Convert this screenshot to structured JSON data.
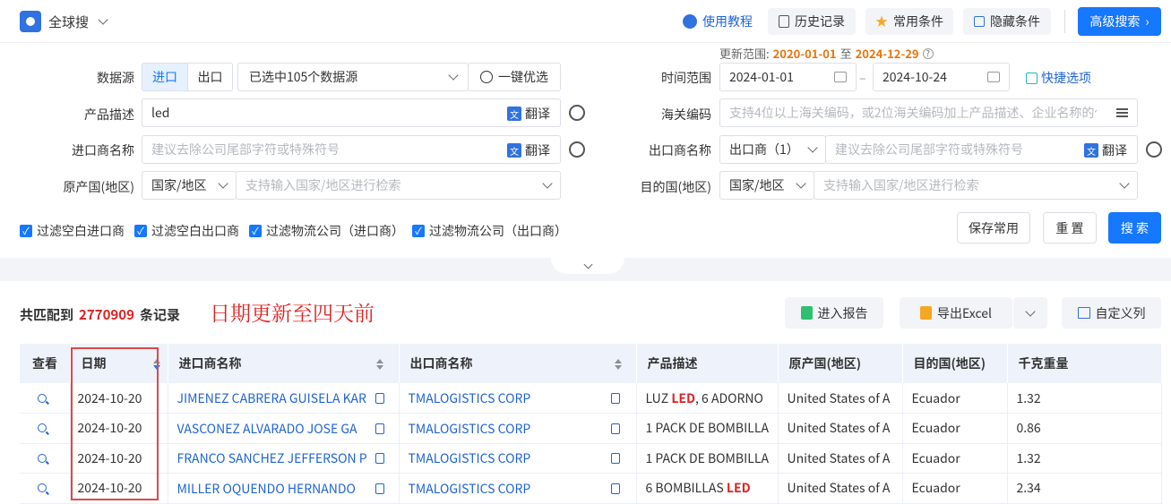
{
  "header": {
    "scope_label": "全球搜",
    "tutorial_label": "使用教程",
    "history_label": "历史记录",
    "favorites_label": "常用条件",
    "hide_label": "隐藏条件",
    "advanced_label": "高级搜索"
  },
  "update_range": {
    "prefix": "更新范围:",
    "start": "2020-01-01",
    "sep": "至",
    "end": "2024-12-29"
  },
  "form": {
    "data_source_label": "数据源",
    "import_label": "进口",
    "export_label": "出口",
    "sources_selected": "已选中105个数据源",
    "one_click_label": "一键优选",
    "time_range_label": "时间范围",
    "date_start": "2024-01-01",
    "date_end": "2024-10-24",
    "quick_options_label": "快捷选项",
    "product_label": "产品描述",
    "product_value": "led",
    "translate_label": "翻译",
    "hs_label": "海关编码",
    "hs_placeholder": "支持4位以上海关编码，或2位海关编码加上产品描述、企业名称的任...",
    "importer_label": "进口商名称",
    "importer_placeholder": "建议去除公司尾部字符或特殊符号",
    "exporter_label": "出口商名称",
    "exporter_select": "出口商（1）",
    "exporter_placeholder": "建议去除公司尾部字符或特殊符号",
    "origin_label": "原产国(地区)",
    "origin_select": "国家/地区",
    "origin_placeholder": "支持输入国家/地区进行检索",
    "dest_label": "目的国(地区)",
    "dest_select": "国家/地区",
    "dest_placeholder": "支持输入国家/地区进行检索",
    "filters": [
      "过滤空白进口商",
      "过滤空白出口商",
      "过滤物流公司（进口商）",
      "过滤物流公司（出口商）"
    ],
    "save_label": "保存常用",
    "reset_label": "重 置",
    "search_label": "搜 索"
  },
  "results": {
    "prefix": "共匹配到",
    "count": "2770909",
    "suffix": "条记录",
    "annotation": "日期更新至四天前",
    "report_label": "进入报告",
    "excel_label": "导出Excel",
    "custom_cols_label": "自定义列"
  },
  "table": {
    "headers": [
      "查看",
      "日期",
      "进口商名称",
      "出口商名称",
      "产品描述",
      "原产国(地区)",
      "目的国(地区)",
      "千克重量"
    ],
    "rows": [
      {
        "date": "2024-10-20",
        "importer": "JIMENEZ CABRERA GUISELA KAR",
        "exporter": "TMALOGISTICS CORP",
        "desc_pre": "LUZ ",
        "desc_hl": "LED",
        "desc_post": ", 6 ADORNO",
        "origin": "United States of A",
        "dest": "Ecuador",
        "weight": "1.32"
      },
      {
        "date": "2024-10-20",
        "importer": "VASCONEZ ALVARADO JOSE GA",
        "exporter": "TMALOGISTICS CORP",
        "desc_pre": "1 PACK DE BOMBILLA",
        "desc_hl": "",
        "desc_post": "",
        "origin": "United States of A",
        "dest": "Ecuador",
        "weight": "0.86"
      },
      {
        "date": "2024-10-20",
        "importer": "FRANCO SANCHEZ JEFFERSON P",
        "exporter": "TMALOGISTICS CORP",
        "desc_pre": "1 PACK DE BOMBILLA",
        "desc_hl": "",
        "desc_post": "",
        "origin": "United States of A",
        "dest": "Ecuador",
        "weight": "1.32"
      },
      {
        "date": "2024-10-20",
        "importer": "MILLER OQUENDO HERNANDO",
        "exporter": "TMALOGISTICS CORP",
        "desc_pre": "6 BOMBILLAS ",
        "desc_hl": "LED",
        "desc_post": "",
        "origin": "United States of A",
        "dest": "Ecuador",
        "weight": "2.34"
      }
    ]
  },
  "colors": {
    "primary": "#1677ff",
    "accent_orange": "#e8740c",
    "highlight_red": "#e02020"
  }
}
